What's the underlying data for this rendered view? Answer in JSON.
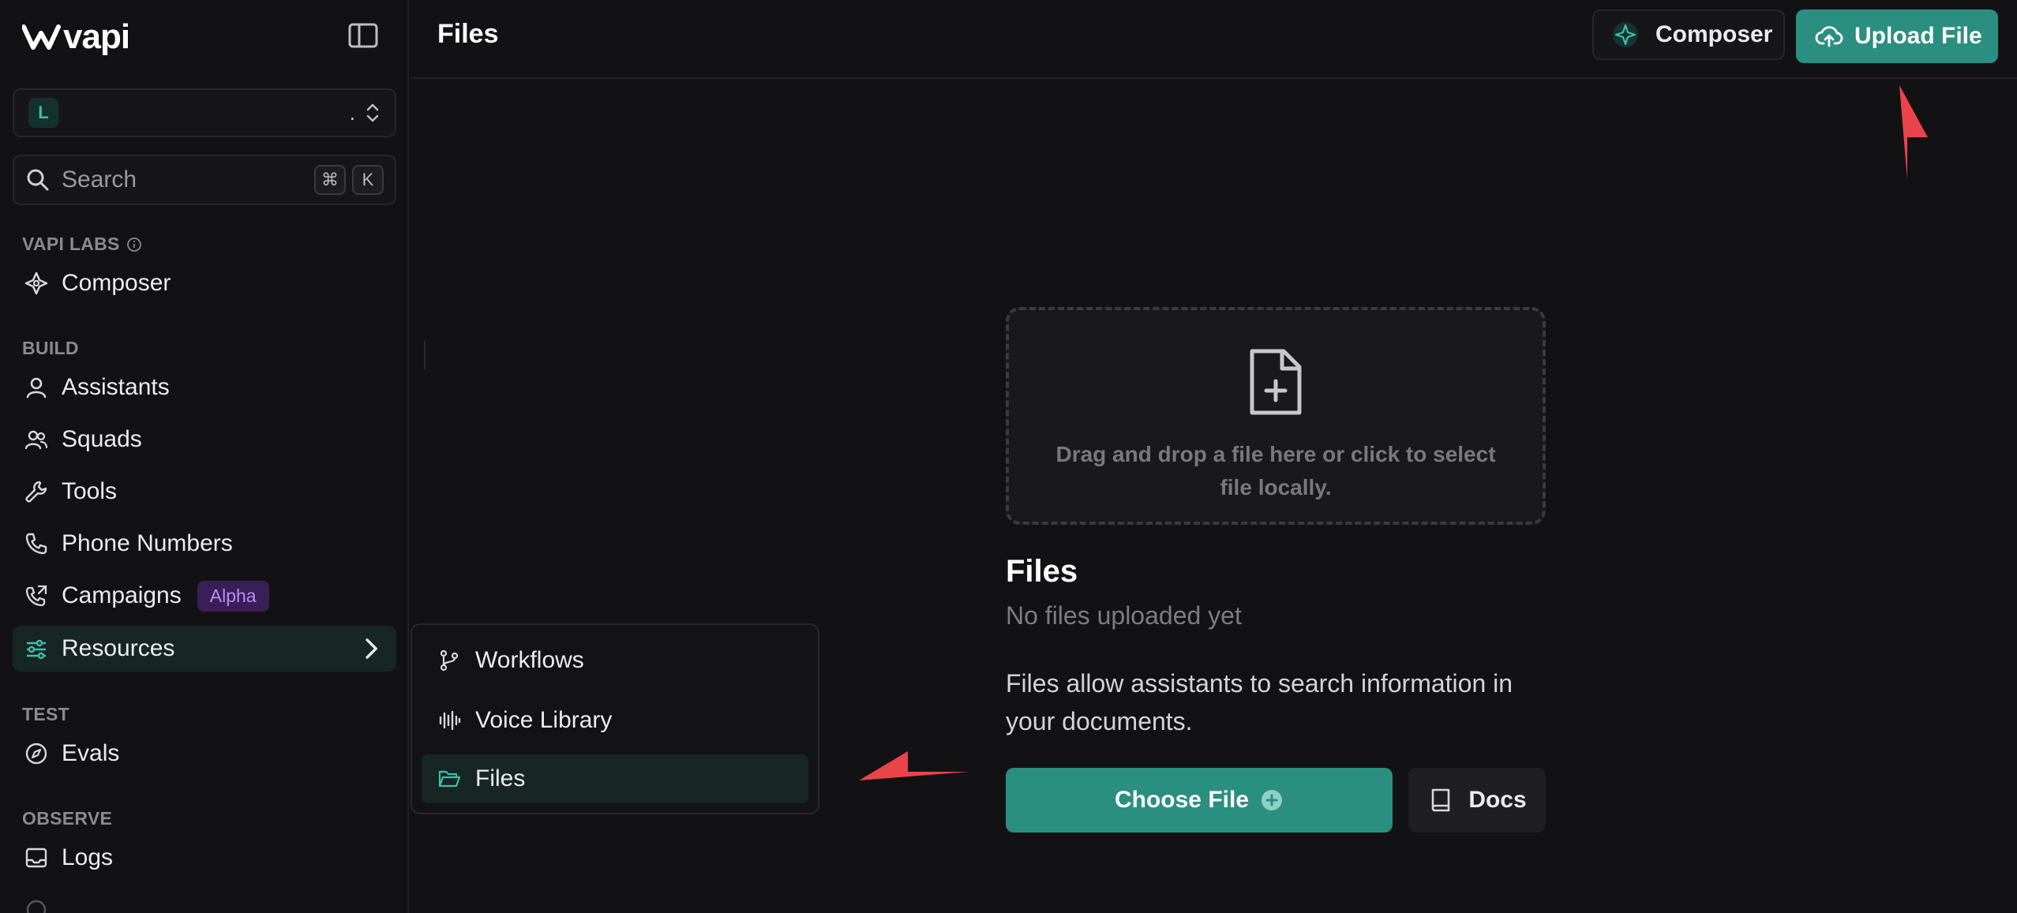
{
  "sidebar": {
    "logo_text": "vapi",
    "org": {
      "avatar_letter": "L",
      "name": "."
    },
    "search": {
      "placeholder": "Search",
      "kbd_cmd": "⌘",
      "kbd_key": "K"
    },
    "sections": {
      "labs": "VAPI LABS",
      "build": "BUILD",
      "test": "TEST",
      "observe": "OBSERVE"
    },
    "items": {
      "composer": "Composer",
      "assistants": "Assistants",
      "squads": "Squads",
      "tools": "Tools",
      "phone_numbers": "Phone Numbers",
      "campaigns": "Campaigns",
      "campaigns_badge": "Alpha",
      "resources": "Resources",
      "evals": "Evals",
      "logs": "Logs"
    }
  },
  "submenu": {
    "workflows": "Workflows",
    "voice_library": "Voice Library",
    "files": "Files"
  },
  "header": {
    "title": "Files",
    "composer_label": "Composer",
    "upload_label": "Upload File"
  },
  "main": {
    "dropzone_text": "Drag and drop a file here or click to select file locally.",
    "heading": "Files",
    "empty_text": "No files uploaded yet",
    "description": "Files allow assistants to search information in your documents.",
    "choose_label": "Choose File",
    "docs_label": "Docs"
  },
  "colors": {
    "accent": "#2a8f80",
    "background": "#121214",
    "annotation_arrow": "#e9444a",
    "alpha_badge": "#3a1e57"
  }
}
